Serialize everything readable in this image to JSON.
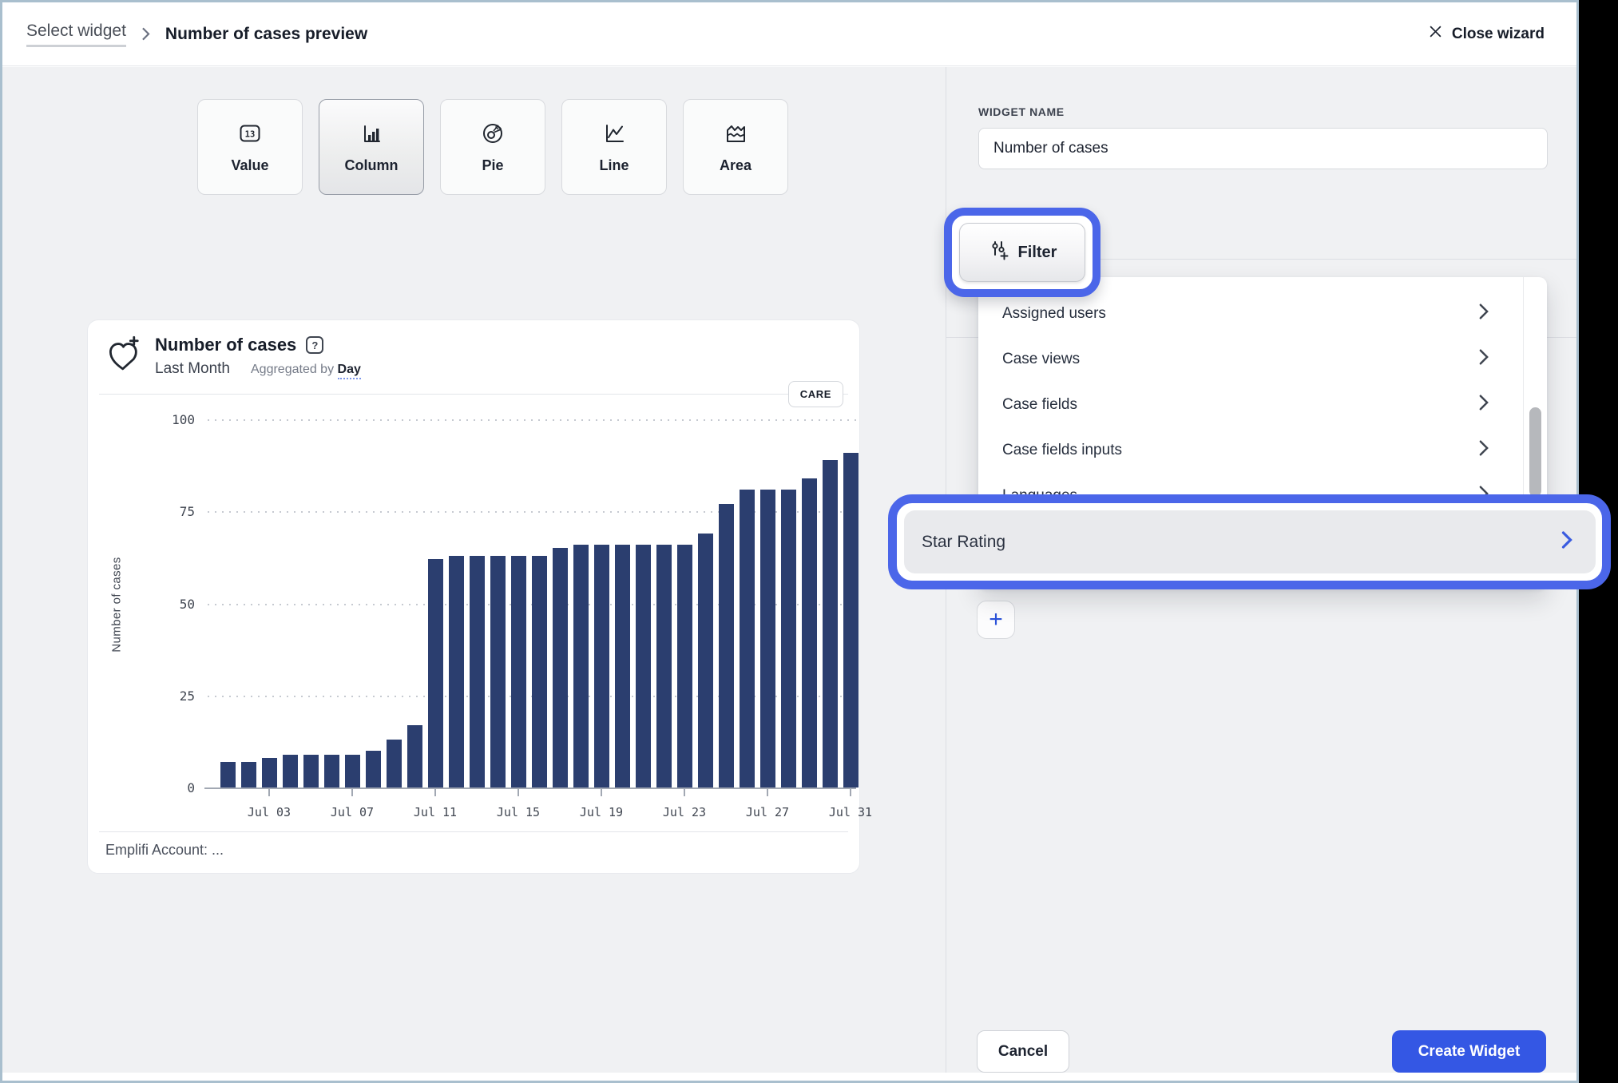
{
  "header": {
    "breadcrumb": {
      "parent": "Select widget",
      "separator": "›",
      "current": "Number of cases preview"
    },
    "close_label": "Close wizard"
  },
  "chart_types": [
    {
      "label": "Value",
      "icon": "value-icon",
      "selected": false
    },
    {
      "label": "Column",
      "icon": "column-icon",
      "selected": true
    },
    {
      "label": "Pie",
      "icon": "pie-icon",
      "selected": false
    },
    {
      "label": "Line",
      "icon": "line-icon",
      "selected": false
    },
    {
      "label": "Area",
      "icon": "area-icon",
      "selected": false
    }
  ],
  "preview_card": {
    "title": "Number of cases",
    "period": "Last Month",
    "aggregated_prefix": "Aggregated by",
    "aggregated_value": "Day",
    "badge": "CARE",
    "footer": "Emplifi Account: ..."
  },
  "chart_data": {
    "type": "bar",
    "title": "Number of cases",
    "period": "Last Month",
    "aggregation": "Day",
    "ylabel": "Number of cases",
    "ylim": [
      0,
      100
    ],
    "yticks": [
      0,
      25,
      50,
      75,
      100
    ],
    "grid": "horizontal-dotted",
    "bar_color": "#2b3e6f",
    "x": [
      "Jul 01",
      "Jul 02",
      "Jul 03",
      "Jul 04",
      "Jul 05",
      "Jul 06",
      "Jul 07",
      "Jul 08",
      "Jul 09",
      "Jul 10",
      "Jul 11",
      "Jul 12",
      "Jul 13",
      "Jul 14",
      "Jul 15",
      "Jul 16",
      "Jul 17",
      "Jul 18",
      "Jul 19",
      "Jul 20",
      "Jul 21",
      "Jul 22",
      "Jul 23",
      "Jul 24",
      "Jul 25",
      "Jul 26",
      "Jul 27",
      "Jul 28",
      "Jul 29",
      "Jul 30",
      "Jul 31"
    ],
    "x_tick_labels": [
      "Jul 03",
      "Jul 07",
      "Jul 11",
      "Jul 15",
      "Jul 19",
      "Jul 23",
      "Jul 27",
      "Jul 31"
    ],
    "values": [
      7,
      7,
      8,
      9,
      9,
      9,
      9,
      10,
      13,
      17,
      62,
      63,
      63,
      63,
      63,
      63,
      65,
      66,
      66,
      66,
      66,
      66,
      66,
      69,
      77,
      81,
      81,
      81,
      84,
      89,
      91
    ]
  },
  "panel": {
    "widget_name_label": "WIDGET NAME",
    "widget_name_value": "Number of cases",
    "filter_button_label": "Filter",
    "filter_options": [
      {
        "label": "Assigned users"
      },
      {
        "label": "Case views"
      },
      {
        "label": "Case fields"
      },
      {
        "label": "Case fields inputs"
      },
      {
        "label": "Languages",
        "partially_hidden": true
      }
    ],
    "highlighted_option": "Star Rating",
    "add_button_label": "+",
    "cancel_label": "Cancel",
    "create_label": "Create Widget"
  },
  "colors": {
    "annotation_blue": "#4b66e9",
    "bar_navy": "#2b3e6f",
    "primary_button_blue": "#3457e4",
    "background_gray": "#f0f1f3",
    "window_border": "#a9bfce"
  }
}
